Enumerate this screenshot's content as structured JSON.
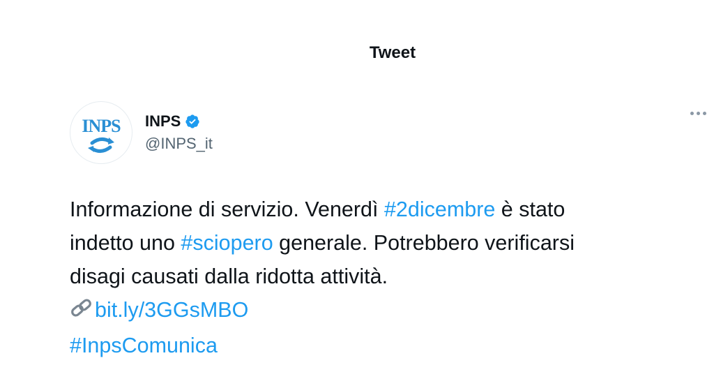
{
  "header": {
    "title": "Tweet"
  },
  "author": {
    "display_name": "INPS",
    "handle": "@INPS_it",
    "verified": true,
    "logo_text": "INPS"
  },
  "tweet": {
    "line1_text": "Informazione di servizio. Venerdì ",
    "hashtag_1": "#2dicembre",
    "line1_end": " è stato",
    "line2_start": "indetto uno ",
    "hashtag_2": "#sciopero",
    "line2_end": " generale. Potrebbero verificarsi",
    "line3": "disagi causati dalla ridotta attività.",
    "link_icon": "link-icon",
    "short_link": "bit.ly/3GGsMBO",
    "hashtag_3": "#InpsComunica"
  },
  "colors": {
    "link": "#1d9bf0",
    "text": "#0f1419",
    "secondary": "#536471",
    "verified": "#1d9bf0",
    "inps_brand": "#2a8fd4"
  }
}
